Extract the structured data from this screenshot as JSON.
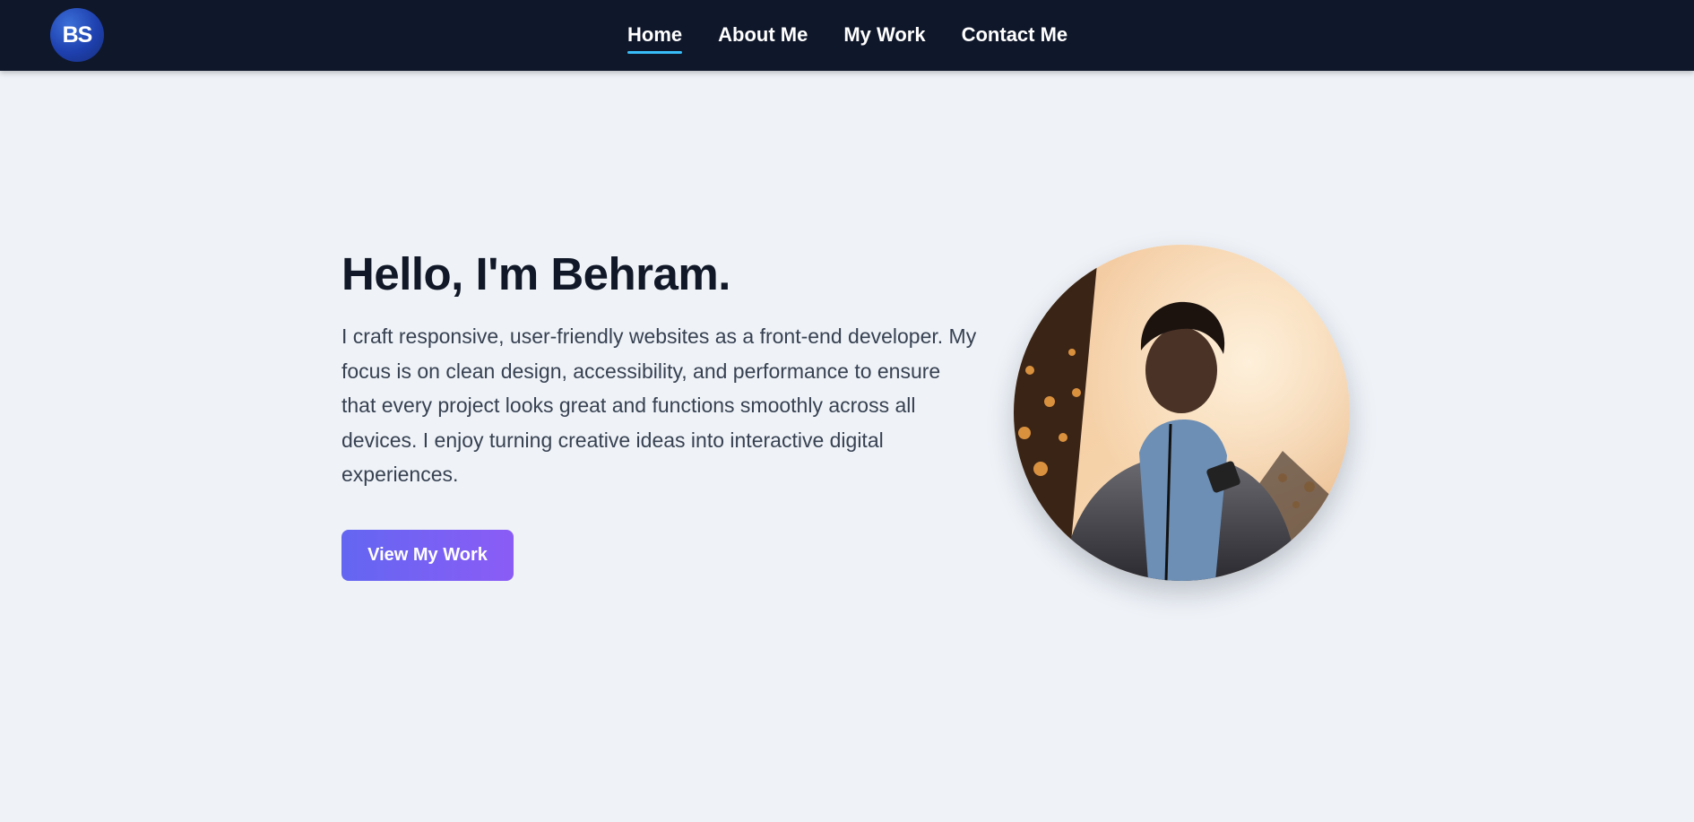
{
  "header": {
    "logo_text": "BS",
    "nav": [
      {
        "label": "Home",
        "active": true
      },
      {
        "label": "About Me",
        "active": false
      },
      {
        "label": "My Work",
        "active": false
      },
      {
        "label": "Contact Me",
        "active": false
      }
    ]
  },
  "hero": {
    "title": "Hello, I'm Behram.",
    "description": "I craft responsive, user-friendly websites as a front-end developer. My focus is on clean design, accessibility, and performance to ensure that every project looks great and functions smoothly across all devices. I enjoy turning creative ideas into interactive digital experiences.",
    "cta_label": "View My Work",
    "photo_icon": "profile-photo"
  },
  "colors": {
    "nav_bg": "#0f172a",
    "page_bg": "#eff3f8",
    "accent_underline": "#38bdf8",
    "button_gradient_start": "#6366f1",
    "button_gradient_end": "#8b5cf6",
    "heading": "#111827",
    "body_text": "#374151"
  }
}
